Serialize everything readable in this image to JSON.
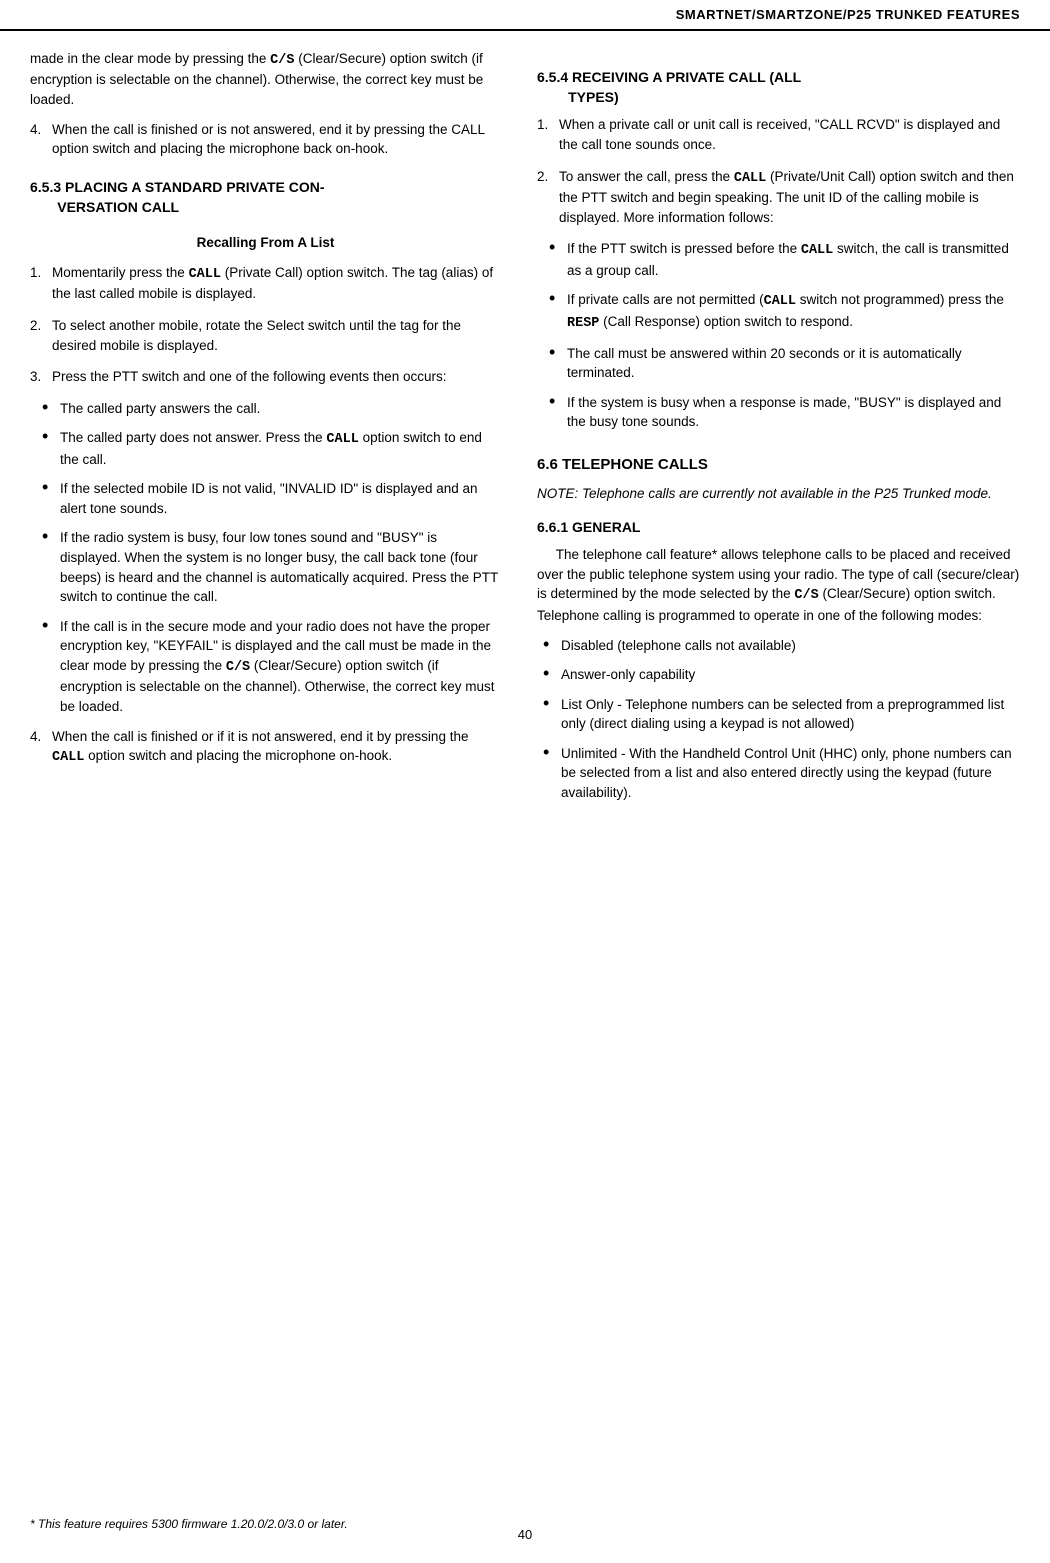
{
  "header": {
    "title": "SMARTNET/SMARTZONE/P25 TRUNKED FEATURES"
  },
  "left_col": {
    "intro_para": "made in the clear mode by pressing the C/S (Clear/Secure) option switch (if encryption is selectable on the channel). Otherwise, the correct key must be loaded.",
    "item4a": {
      "num": "4.",
      "text": "When the call is finished or is not answered, end it by pressing the CALL option switch and placing the microphone back on-hook."
    },
    "section653": {
      "heading": "6.5.3  PLACING A STANDARD PRIVATE CON-\n       VERSATION CALL",
      "subheading": "Recalling From A List"
    },
    "items653": [
      {
        "num": "1.",
        "text_before": "Momentarily press the ",
        "bold": "CALL",
        "text_after": " (Private Call) option switch. The tag (alias) of the last called mobile is displayed."
      },
      {
        "num": "2.",
        "text": "To select another mobile, rotate the Select switch until the tag for the desired mobile is displayed."
      },
      {
        "num": "3.",
        "text": "Press the PTT switch and one of the following events then occurs:"
      }
    ],
    "bullets653": [
      {
        "text": "The called party answers the call."
      },
      {
        "text_before": "The called party does not answer. Press the ",
        "bold": "CALL",
        "text_after": " option switch to end the call."
      },
      {
        "text": "If the selected mobile ID is not valid, “INVALID ID” is displayed and an alert tone sounds."
      },
      {
        "text": "If the radio system is busy, four low tones sound and “BUSY” is displayed. When the system is no longer busy, the call back tone (four beeps) is heard and the channel is automatically acquired. Press the PTT switch to continue the call."
      },
      {
        "text_before": "If the call is in the secure mode and your radio does not have the proper encryption key, “KEYFAIL” is displayed and the call must be made in the clear mode by pressing the ",
        "bold": "C/S",
        "text_after": " (Clear/Secure) option switch (if encryption is selectable on the channel). Otherwise, the correct key must be loaded."
      }
    ],
    "item4b": {
      "num": "4.",
      "text_before": "When the call is finished or if it is not answered, end it by pressing the ",
      "bold": "CALL",
      "text_after": " option switch and placing the microphone on-hook."
    }
  },
  "right_col": {
    "section654": {
      "heading": "6.5.4  RECEIVING A PRIVATE CALL (ALL\n        TYPES)"
    },
    "items654": [
      {
        "num": "1.",
        "text": "When a private call or unit call is received, “CALL RCVD” is displayed and the call tone sounds once."
      },
      {
        "num": "2.",
        "text_before": "To answer the call, press the ",
        "bold": "CALL",
        "text_after": " (Private/Unit Call) option switch and then the PTT switch and begin speaking. The unit ID of the calling mobile is displayed. More information follows:"
      }
    ],
    "bullets654": [
      {
        "text_before": "If the PTT switch is pressed before the ",
        "bold": "CALL",
        "text_after": " switch, the call is transmitted as a group call."
      },
      {
        "text_before": "If private calls are not permitted (",
        "bold": "CALL",
        "text_mid": " switch not programmed) press the ",
        "bold2": "RESP",
        "text_after": " (Call Response) option switch to respond."
      },
      {
        "text": "The call must be answered within 20 seconds or it is automatically terminated."
      },
      {
        "text": "If the system is busy when a response is made, “BUSY” is displayed and the busy tone sounds."
      }
    ],
    "section66": {
      "heading": "6.6 TELEPHONE CALLS"
    },
    "note66": "NOTE: Telephone calls are currently not available in the P25 Trunked mode.",
    "section661": {
      "heading": "6.6.1  GENERAL"
    },
    "para661": {
      "text_before": "The telephone call feature* allows telephone calls to be placed and received over the public telephone system using your radio. The type of call (secure/clear) is determined by the mode selected by the ",
      "bold": "C/S",
      "text_after": " (Clear/Secure) option switch. Telephone calling is programmed to operate in one of the following modes:"
    },
    "modes": [
      "Disabled (telephone calls not available)",
      "Answer-only capability",
      "List Only - Telephone numbers can be selected from a preprogrammed list only (direct dialing using a keypad is not allowed)",
      "Unlimited - With the Handheld Control Unit (HHC) only, phone numbers can be selected from a list and also entered directly using the keypad (future availability)."
    ]
  },
  "footer": {
    "note": "* This feature requires 5300 firmware 1.20.0/2.0/3.0 or later.",
    "page_number": "40"
  }
}
